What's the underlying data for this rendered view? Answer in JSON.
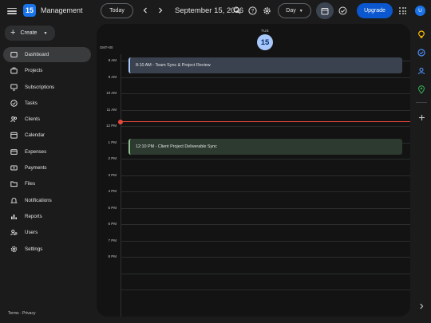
{
  "header": {
    "app_title": "Management",
    "logo_text": "15",
    "today_label": "Today",
    "date_title": "September 15, 2026",
    "view_label": "Day",
    "upgrade_label": "Upgrade",
    "avatar_initial": "U"
  },
  "sidebar": {
    "create_label": "Create",
    "items": [
      {
        "label": "Dashboard",
        "icon": "dashboard-icon",
        "active": true
      },
      {
        "label": "Projects",
        "icon": "briefcase-icon"
      },
      {
        "label": "Subscriptions",
        "icon": "monitor-icon"
      },
      {
        "label": "Tasks",
        "icon": "check-circle-icon"
      },
      {
        "label": "Clients",
        "icon": "people-icon"
      },
      {
        "label": "Calendar",
        "icon": "calendar-icon"
      },
      {
        "label": "Expenses",
        "icon": "wallet-icon"
      },
      {
        "label": "Payments",
        "icon": "payments-icon"
      },
      {
        "label": "Files",
        "icon": "folder-icon"
      },
      {
        "label": "Notifications",
        "icon": "bell-icon"
      },
      {
        "label": "Reports",
        "icon": "bar-chart-icon"
      },
      {
        "label": "Users",
        "icon": "users-icon"
      },
      {
        "label": "Settings",
        "icon": "gear-icon"
      }
    ],
    "footer": "Terms · Privacy"
  },
  "calendar": {
    "day_of_week": "TUE",
    "day_number": "15",
    "timezone": "GMT+00",
    "hours": [
      "8 AM",
      "9 AM",
      "10 AM",
      "11 AM",
      "12 PM",
      "1 PM",
      "2 PM",
      "3 PM",
      "4 PM",
      "5 PM",
      "6 PM",
      "7 PM",
      "8 PM"
    ],
    "events": [
      {
        "label": "8:10 AM - Team Sync & Project Review",
        "color": "#a8c7fa"
      },
      {
        "label": "12:10 PM - Client Project Deliverable Sync",
        "color": "#8fbf8f"
      }
    ]
  },
  "colors": {
    "accent": "#0b57d0",
    "now_line": "#e5483c"
  },
  "right_rail": {
    "icons": [
      "keep-icon",
      "tasks-icon",
      "contacts-icon",
      "maps-icon",
      "add-icon",
      "expand-icon"
    ]
  }
}
